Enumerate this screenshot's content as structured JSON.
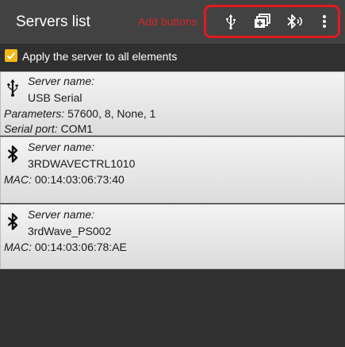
{
  "header": {
    "title": "Servers list",
    "annotation": "Add buttons",
    "highlight_color": "#e0191f",
    "buttons": [
      {
        "icon": "usb-icon"
      },
      {
        "icon": "add-library-icon"
      },
      {
        "icon": "bluetooth-searching-icon"
      },
      {
        "icon": "more-vert-icon"
      }
    ]
  },
  "apply_all": {
    "checked": true,
    "label": "Apply the server to all elements",
    "color": "#f2b81a"
  },
  "servers": [
    {
      "icon": "usb-icon",
      "name_label": "Server name:",
      "name": "USB Serial",
      "params_label": "Parameters:",
      "params": "57600, 8, None, 1",
      "port_label": "Serial port:",
      "port": "COM1"
    },
    {
      "icon": "bluetooth-icon",
      "name_label": "Server name:",
      "name": "3RDWAVECTRL1010",
      "mac_label": "MAC:",
      "mac": "00:14:03:06:73:40"
    },
    {
      "icon": "bluetooth-icon",
      "name_label": "Server name:",
      "name": "3rdWave_PS002",
      "mac_label": "MAC:",
      "mac": "00:14:03:06:78:AE"
    }
  ],
  "colors": {
    "appbar": "#424242",
    "background": "#303030",
    "annotation_text": "#d2262c"
  }
}
